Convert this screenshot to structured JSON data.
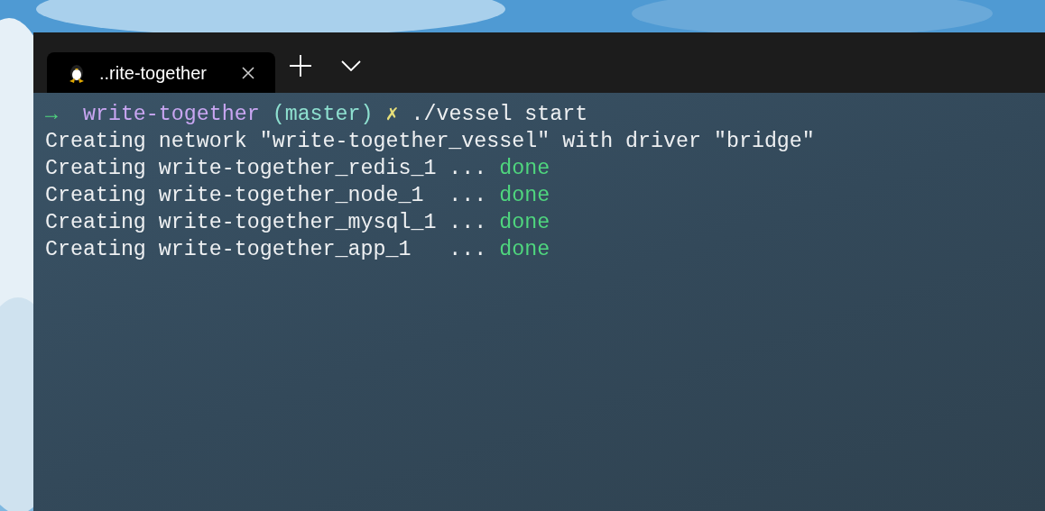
{
  "tabs": [
    {
      "title": "..rite-together",
      "selected": true
    }
  ],
  "terminal": {
    "lines": [
      {
        "segments": [
          {
            "kind": "arrow",
            "text": "→  "
          },
          {
            "kind": "directory",
            "text": "write-together "
          },
          {
            "kind": "branch",
            "text": "(master) "
          },
          {
            "kind": "dirty",
            "text": "✗ "
          },
          {
            "kind": "plain",
            "text": "./vessel start"
          }
        ]
      },
      {
        "segments": [
          {
            "kind": "plain",
            "text": "Creating network \"write-together_vessel\" with driver \"bridge\""
          }
        ]
      },
      {
        "segments": [
          {
            "kind": "plain",
            "text": "Creating write-together_redis_1 ... "
          },
          {
            "kind": "success",
            "text": "done"
          }
        ]
      },
      {
        "segments": [
          {
            "kind": "plain",
            "text": "Creating write-together_node_1  ... "
          },
          {
            "kind": "success",
            "text": "done"
          }
        ]
      },
      {
        "segments": [
          {
            "kind": "plain",
            "text": "Creating write-together_mysql_1 ... "
          },
          {
            "kind": "success",
            "text": "done"
          }
        ]
      },
      {
        "segments": [
          {
            "kind": "plain",
            "text": "Creating write-together_app_1   ... "
          },
          {
            "kind": "success",
            "text": "done"
          }
        ]
      }
    ]
  }
}
